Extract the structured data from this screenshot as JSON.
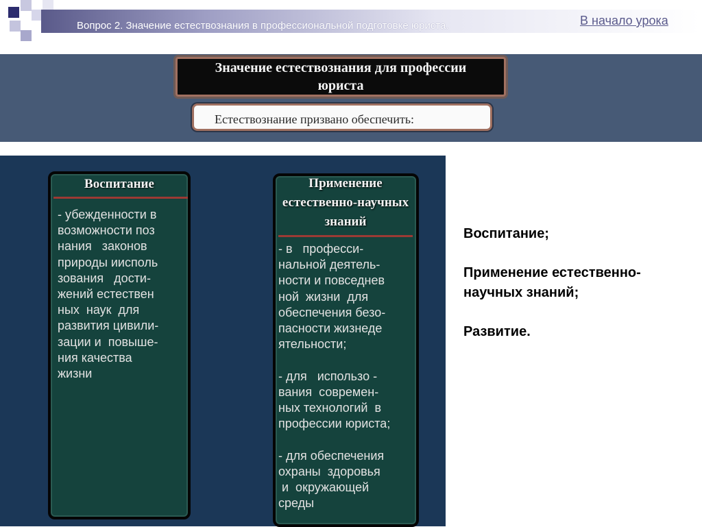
{
  "header": {
    "topic": "Вопрос 2. Значение естествознания в профессиональной подготовке юриста.",
    "home_link": "В начало урока"
  },
  "title_box": {
    "line1": "Значение естествознания для профессии",
    "line2": "юриста"
  },
  "subtitle": "Естествознание призвано обеспечить:",
  "columns": [
    {
      "heading": "Воспитание",
      "text": "- убежденности в\nвозможности поз\nнания   законов\nприроды иисполь\nзования   дости-\nжений естествен\nных  наук  для\nразвития цивили-\nзации и  повыше-\nния качества\nжизни"
    },
    {
      "heading": "Применение\nестественно-научных\nзнаний",
      "text": "- в   професси-\nнальной деятель-\nности и повседнев\nной  жизни  для\nобеспечения безо-\nпасности жизнеде\nятельности;\n\n- для   использо -\nвания  современ-\nных технологий  в\nпрофессии юриста;\n\n- для обеспечения\nохраны  здоровья\n и  окружающей\nсреды"
    }
  ],
  "summary": {
    "item1": "Воспитание;",
    "item2": "Применение естественно-\nнаучных знаний;",
    "item3": "Развитие."
  }
}
